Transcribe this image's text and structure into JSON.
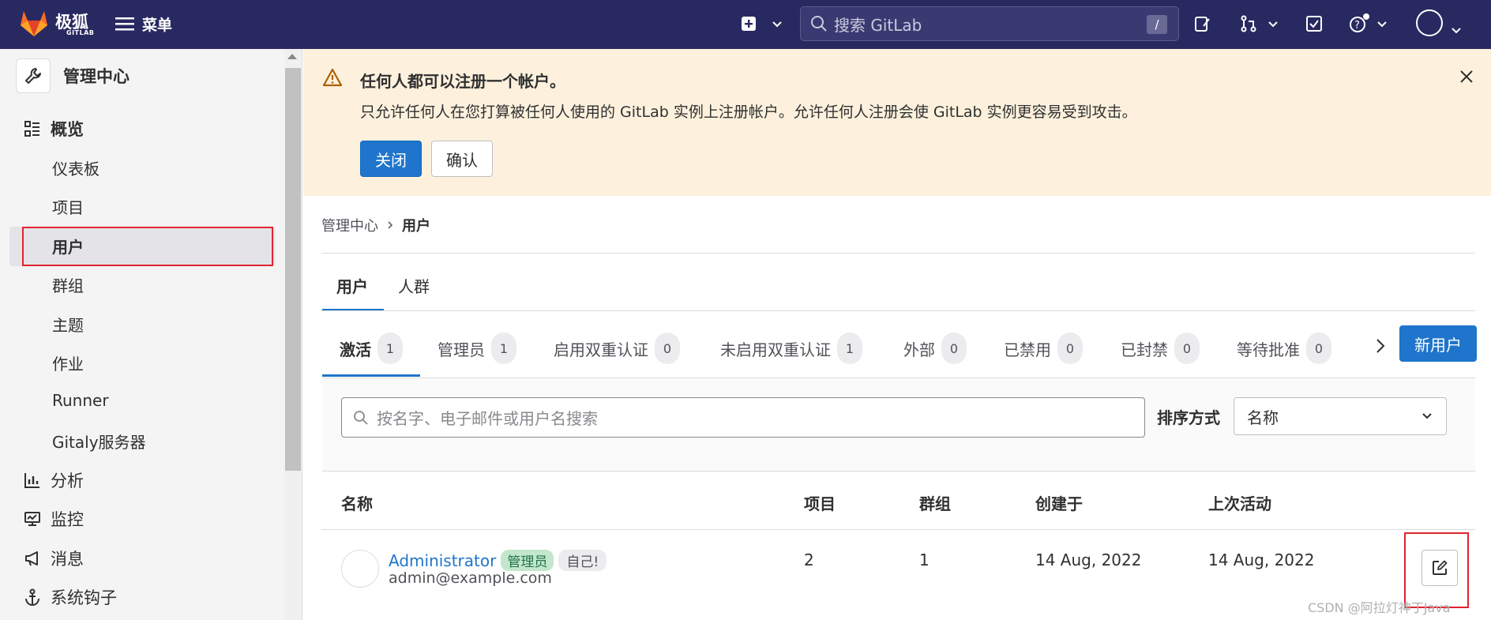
{
  "topbar": {
    "brand": "极狐",
    "brand_sub": "GITLAB",
    "menu_label": "菜单",
    "search_placeholder": "搜索 GitLab",
    "search_shortcut": "/"
  },
  "sidebar": {
    "header": "管理中心",
    "overview": "概览",
    "sub_items": [
      "仪表板",
      "项目",
      "用户",
      "群组",
      "主题",
      "作业",
      "Runner",
      "Gitaly服务器"
    ],
    "items": [
      "分析",
      "监控",
      "消息",
      "系统钩子"
    ]
  },
  "alert": {
    "title": "任何人都可以注册一个帐户。",
    "body": "只允许任何人在您打算被任何人使用的 GitLab 实例上注册帐户。允许任何人注册会使 GitLab 实例更容易受到攻击。",
    "primary_button": "关闭",
    "secondary_button": "确认"
  },
  "breadcrumb": {
    "parent": "管理中心",
    "current": "用户"
  },
  "main_tabs": [
    "用户",
    "人群"
  ],
  "filter_tabs": [
    {
      "label": "激活",
      "count": "1"
    },
    {
      "label": "管理员",
      "count": "1"
    },
    {
      "label": "启用双重认证",
      "count": "0"
    },
    {
      "label": "未启用双重认证",
      "count": "1"
    },
    {
      "label": "外部",
      "count": "0"
    },
    {
      "label": "已禁用",
      "count": "0"
    },
    {
      "label": "已封禁",
      "count": "0"
    },
    {
      "label": "等待批准",
      "count": "0"
    }
  ],
  "new_user_button": "新用户",
  "search_users_placeholder": "按名字、电子邮件或用户名搜索",
  "sort": {
    "label": "排序方式",
    "selected": "名称"
  },
  "table": {
    "headers": [
      "名称",
      "项目",
      "群组",
      "创建于",
      "上次活动"
    ],
    "rows": [
      {
        "name": "Administrator",
        "badge_admin": "管理员",
        "badge_self": "自己!",
        "email": "admin@example.com",
        "projects": "2",
        "groups": "1",
        "created": "14 Aug, 2022",
        "last_activity": "14 Aug, 2022"
      }
    ]
  },
  "watermark": "CSDN @阿拉灯神丁Java",
  "colors": {
    "topbar": "#292961",
    "primary": "#1f75cb",
    "alert_bg": "#fdf1dd",
    "highlight_outline": "#e0242e"
  }
}
